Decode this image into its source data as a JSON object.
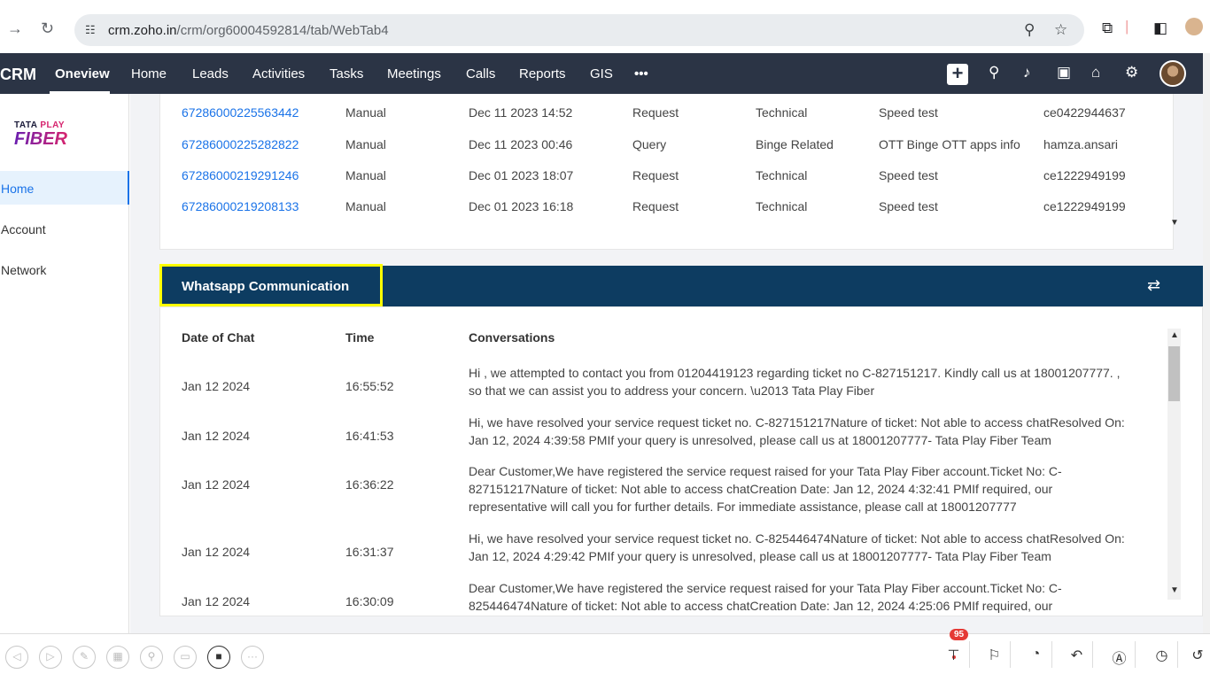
{
  "browser": {
    "url_host": "crm.zoho.in",
    "url_path": "/crm/org60004592814/tab/WebTab4"
  },
  "crm": {
    "brand": "CRM",
    "tabs": [
      "Oneview",
      "Home",
      "Leads",
      "Activities",
      "Tasks",
      "Meetings",
      "Calls",
      "Reports",
      "GIS",
      "•••"
    ],
    "active_tab": "Oneview"
  },
  "sidebar": {
    "logo_line1_a": "TATA",
    "logo_line1_b": "PLAY",
    "logo_line2": "FIBER",
    "items": [
      {
        "label": "Home",
        "active": true
      },
      {
        "label": "Account",
        "active": false
      },
      {
        "label": "Network",
        "active": false
      }
    ]
  },
  "tickets": [
    {
      "id": "67286000225563442",
      "mode": "Manual",
      "date": "Dec 11 2023 14:52",
      "type": "Request",
      "category": "Technical",
      "sub": "Speed test",
      "user": "ce0422944637"
    },
    {
      "id": "67286000225282822",
      "mode": "Manual",
      "date": "Dec 11 2023 00:46",
      "type": "Query",
      "category": "Binge Related",
      "sub": "OTT Binge OTT apps info",
      "user": "hamza.ansari"
    },
    {
      "id": "67286000219291246",
      "mode": "Manual",
      "date": "Dec 01 2023 18:07",
      "type": "Request",
      "category": "Technical",
      "sub": "Speed test",
      "user": "ce1222949199"
    },
    {
      "id": "67286000219208133",
      "mode": "Manual",
      "date": "Dec 01 2023 16:18",
      "type": "Request",
      "category": "Technical",
      "sub": "Speed test",
      "user": "ce1222949199"
    }
  ],
  "whatsapp": {
    "title": "Whatsapp Communication",
    "headers": {
      "date": "Date of Chat",
      "time": "Time",
      "conv": "Conversations"
    },
    "rows": [
      {
        "date": "Jan 12 2024",
        "time": "16:55:52",
        "msg": "Hi , we attempted to contact you from 01204419123 regarding ticket no C-827151217. Kindly call us at 18001207777. , so that we can assist you to address your concern. \\u2013 Tata Play Fiber"
      },
      {
        "date": "Jan 12 2024",
        "time": "16:41:53",
        "msg": "Hi, we have resolved your service request ticket no. C-827151217Nature of ticket: Not able to access chatResolved On: Jan 12, 2024 4:39:58 PMIf your query is unresolved, please call us at 18001207777- Tata Play Fiber Team"
      },
      {
        "date": "Jan 12 2024",
        "time": "16:36:22",
        "msg": "Dear Customer,We have registered the service request raised for your Tata Play Fiber account.Ticket No: C-827151217Nature of ticket: Not able to access chatCreation Date: Jan 12, 2024 4:32:41 PMIf required, our representative will call you for further details. For immediate assistance, please call at 18001207777"
      },
      {
        "date": "Jan 12 2024",
        "time": "16:31:37",
        "msg": "Hi, we have resolved your service request ticket no. C-825446474Nature of ticket: Not able to access chatResolved On: Jan 12, 2024 4:29:42 PMIf your query is unresolved, please call us at 18001207777- Tata Play Fiber Team"
      },
      {
        "date": "Jan 12 2024",
        "time": "16:30:09",
        "msg": "Dear Customer,We have registered the service request raised for your Tata Play Fiber account.Ticket No: C-825446474Nature of ticket: Not able to access chatCreation Date: Jan 12, 2024 4:25:06 PMIf required, our representative will call you for further details."
      }
    ]
  },
  "bottom": {
    "badge": "95"
  }
}
